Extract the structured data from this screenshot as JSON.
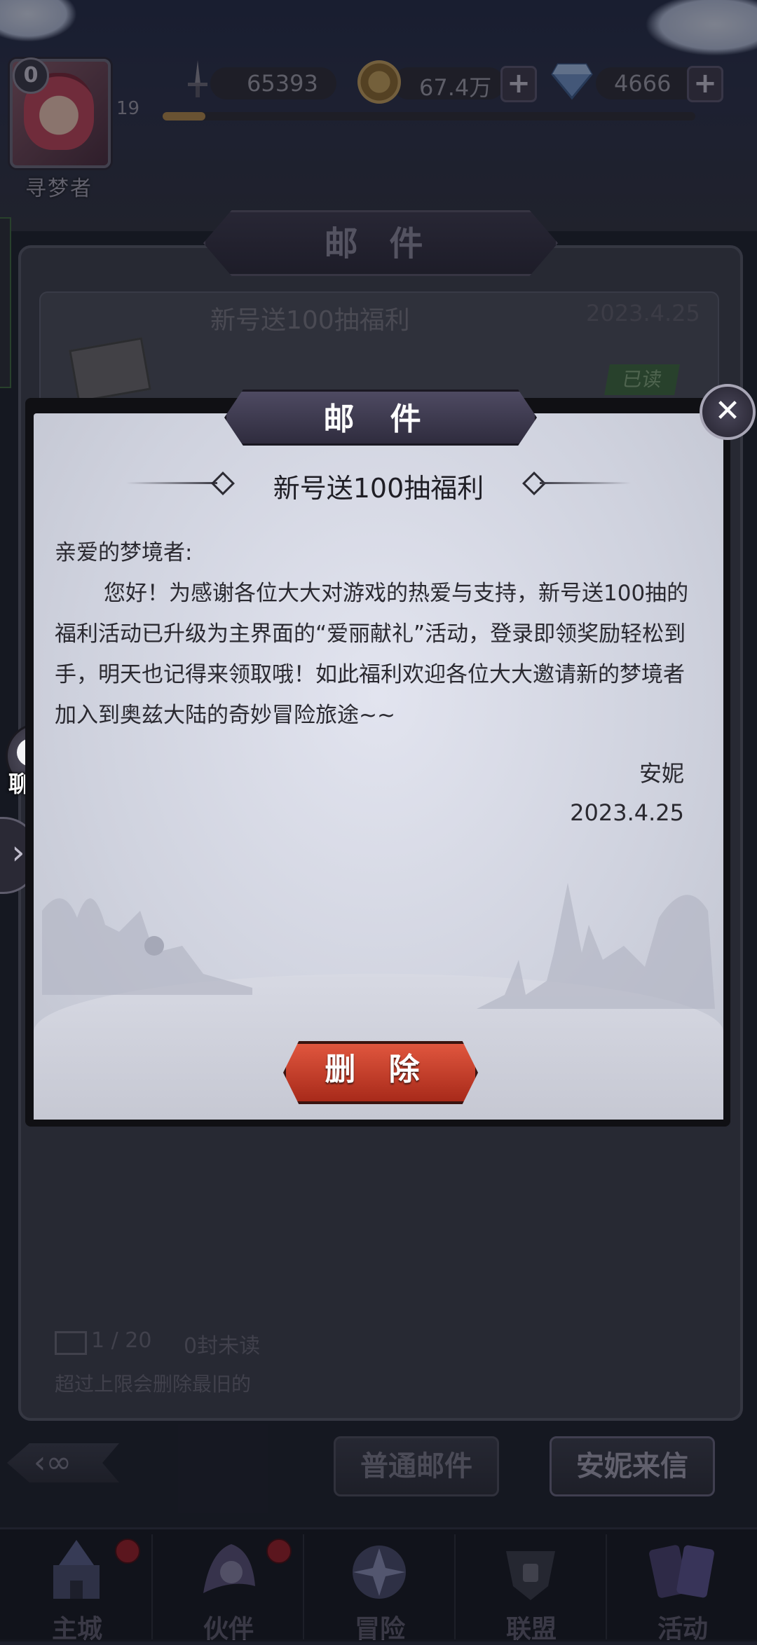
{
  "hud": {
    "vip_level": "0",
    "player_level": "19",
    "player_title": "寻梦者",
    "exp_progress": 0.08,
    "power": "65393",
    "gold": "67.4万",
    "gems": "4666",
    "plus_symbol": "+"
  },
  "mail_panel": {
    "title": "邮 件",
    "list": [
      {
        "subject": "新号送100抽福利",
        "date": "2023.4.25",
        "status": "已读"
      }
    ],
    "footer": {
      "count": "1 / 20",
      "unread": "0封未读",
      "note": "超过上限会删除最旧的"
    }
  },
  "filter_tabs": [
    {
      "label": "普通邮件"
    },
    {
      "label": "安妮来信"
    }
  ],
  "back_symbol": "‹∞",
  "bottom_nav": [
    {
      "label": "主城",
      "icon": "castle-icon",
      "badge": true
    },
    {
      "label": "伙伴",
      "icon": "partner-icon",
      "badge": true
    },
    {
      "label": "冒险",
      "icon": "adventure-icon",
      "badge": false
    },
    {
      "label": "联盟",
      "icon": "alliance-icon",
      "badge": false
    },
    {
      "label": "活动",
      "icon": "cards-icon",
      "badge": false
    }
  ],
  "modal": {
    "title": "邮 件",
    "close_symbol": "✕",
    "subject": "新号送100抽福利",
    "greeting": "亲爱的梦境者:",
    "content": "您好！为感谢各位大大对游戏的热爱与支持，新号送100抽的福利活动已升级为主界面的“爱丽献礼”活动，登录即领奖励轻松到手，明天也记得来领取哦！如此福利欢迎各位大大邀请新的梦境者加入到奥兹大陆的奇妙冒险旅途~~",
    "sender": "安妮",
    "date": "2023.4.25",
    "delete_label": "删 除"
  },
  "chat": {
    "label": "聊天",
    "dots": "···"
  },
  "side_expand_symbol": "›",
  "colors": {
    "accent_red": "#c2402c",
    "modal_bg": "#d9dbe6",
    "hud_bg": "#2a2f48",
    "badge_red": "#9c1d26"
  }
}
